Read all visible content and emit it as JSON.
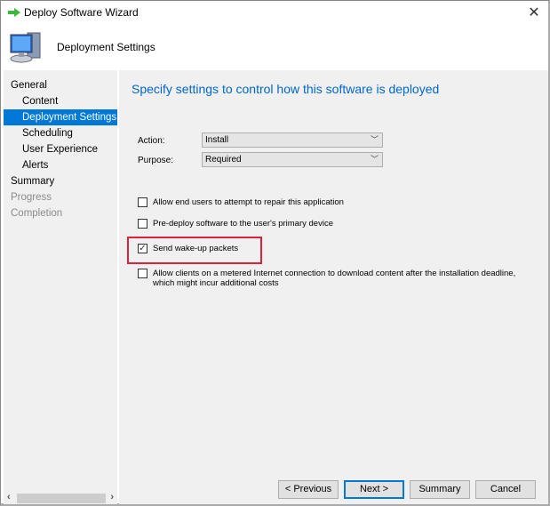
{
  "window": {
    "title": "Deploy Software Wizard",
    "header": "Deployment Settings"
  },
  "nav": [
    {
      "label": "General",
      "level": 1,
      "state": "normal"
    },
    {
      "label": "Content",
      "level": 2,
      "state": "normal"
    },
    {
      "label": "Deployment Settings",
      "level": 2,
      "state": "selected"
    },
    {
      "label": "Scheduling",
      "level": 2,
      "state": "normal"
    },
    {
      "label": "User Experience",
      "level": 2,
      "state": "normal"
    },
    {
      "label": "Alerts",
      "level": 2,
      "state": "normal"
    },
    {
      "label": "Summary",
      "level": 1,
      "state": "normal"
    },
    {
      "label": "Progress",
      "level": 1,
      "state": "disabled"
    },
    {
      "label": "Completion",
      "level": 1,
      "state": "disabled"
    }
  ],
  "main": {
    "heading": "Specify settings to control how this software is deployed",
    "action": {
      "label": "Action:",
      "value": "Install"
    },
    "purpose": {
      "label": "Purpose:",
      "value": "Required"
    },
    "checkboxes": [
      {
        "label": "Allow end users to attempt to repair this application",
        "checked": false
      },
      {
        "label": "Pre-deploy software to the user's primary device",
        "checked": false
      },
      {
        "label": "Send wake-up packets",
        "checked": true
      },
      {
        "label": "Allow clients on a metered Internet connection to download content after the installation deadline, which might incur additional costs",
        "checked": false
      }
    ]
  },
  "buttons": {
    "previous": "< Previous",
    "next": "Next >",
    "summary": "Summary",
    "cancel": "Cancel"
  },
  "colors": {
    "accent": "#0078d7",
    "heading": "#0066cc",
    "highlight": "#e0203c"
  }
}
